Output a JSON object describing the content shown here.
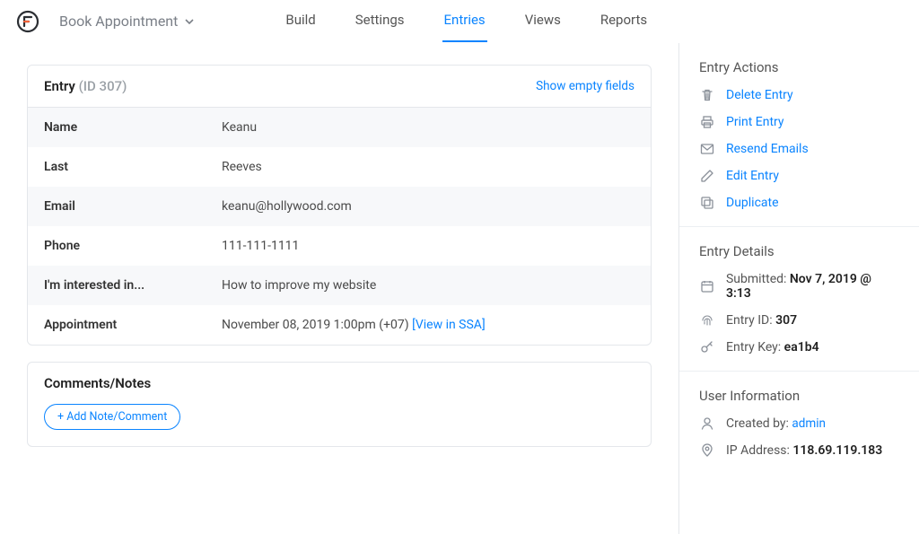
{
  "header": {
    "form_name": "Book Appointment",
    "tabs": [
      "Build",
      "Settings",
      "Entries",
      "Views",
      "Reports"
    ],
    "active_tab_index": 2
  },
  "entry_card": {
    "title_prefix": "Entry",
    "title_suffix": "(ID 307)",
    "show_empty_label": "Show empty fields",
    "fields": [
      {
        "label": "Name",
        "value": "Keanu"
      },
      {
        "label": "Last",
        "value": "Reeves"
      },
      {
        "label": "Email",
        "value": "keanu@hollywood.com"
      },
      {
        "label": "Phone",
        "value": "111-111-1111"
      },
      {
        "label": "I'm interested in...",
        "value": "How to improve my website"
      },
      {
        "label": "Appointment",
        "value": "November 08, 2019 1:00pm (+07)",
        "link_text": "[View in SSA]"
      }
    ]
  },
  "comments": {
    "title": "Comments/Notes",
    "add_label": "+ Add Note/Comment"
  },
  "sidebar": {
    "actions_title": "Entry Actions",
    "actions": [
      {
        "icon": "trash-icon",
        "label": "Delete Entry"
      },
      {
        "icon": "print-icon",
        "label": "Print Entry"
      },
      {
        "icon": "mail-icon",
        "label": "Resend Emails"
      },
      {
        "icon": "pencil-icon",
        "label": "Edit Entry"
      },
      {
        "icon": "duplicate-icon",
        "label": "Duplicate"
      }
    ],
    "details_title": "Entry Details",
    "details": [
      {
        "icon": "calendar-icon",
        "label": "Submitted: ",
        "value": "Nov 7, 2019 @ 3:13"
      },
      {
        "icon": "fingerprint-icon",
        "label": "Entry ID: ",
        "value": "307"
      },
      {
        "icon": "key-icon",
        "label": "Entry Key: ",
        "value": "ea1b4"
      }
    ],
    "user_title": "User Information",
    "user": [
      {
        "icon": "user-icon",
        "label": "Created by: ",
        "link": "admin"
      },
      {
        "icon": "location-icon",
        "label": "IP Address: ",
        "value": "118.69.119.183"
      }
    ]
  }
}
